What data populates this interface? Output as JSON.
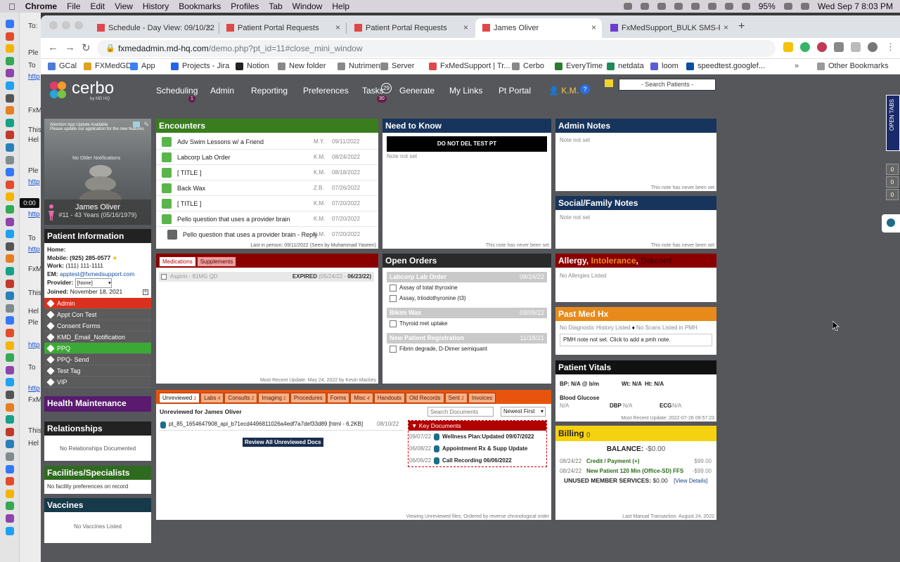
{
  "menubar": {
    "app": "Chrome",
    "items": [
      "File",
      "Edit",
      "View",
      "History",
      "Bookmarks",
      "Profiles",
      "Tab",
      "Window",
      "Help"
    ],
    "battery": "95%",
    "datetime": "Wed Sep 7  8:03 PM"
  },
  "behind": {
    "lines": [
      "To:",
      "Ple",
      "To",
      "http",
      "FxM",
      "This",
      "Hel",
      "Ple",
      "http",
      "Ple",
      "http",
      "To",
      "http",
      "FxM",
      "This",
      "Hel",
      "Ple",
      "http",
      "To",
      "http",
      "FxM",
      "This",
      "Hel"
    ],
    "timer": "0:00"
  },
  "tabs": [
    {
      "label": "Schedule - Day View: 09/10/22"
    },
    {
      "label": "Patient Portal Requests"
    },
    {
      "label": "Patient Portal Requests"
    },
    {
      "label": "James Oliver"
    },
    {
      "label": "FxMedSupport_BULK SMS-REP"
    }
  ],
  "address": {
    "host": "fxmedadmin.md-hq.com",
    "path": "/demo.php?pt_id=11#close_mini_window"
  },
  "bookmarks": [
    "GCal",
    "FXMedGD",
    "App",
    "Projects - Jira",
    "Notion",
    "New folder",
    "Nutrimentrx",
    "Server",
    "FxMedSupport | Tr...",
    "Cerbo",
    "EveryTime",
    "netdata",
    "loom",
    "speedtest.googlef..."
  ],
  "other_bookmarks": "Other Bookmarks",
  "nav": {
    "logo": "cerbo",
    "logo_sub": "by MD HQ",
    "items": [
      "Scheduling",
      "Admin",
      "Reporting",
      "Preferences",
      "Tasks",
      "Generate",
      "My Links",
      "Pt Portal"
    ],
    "scheduling_badge": "1",
    "tasks_count": "29",
    "tasks_badge": "30",
    "user": "K.M.",
    "help": "?",
    "search": "- Search Patients -"
  },
  "open_tabs": {
    "label": "OPEN TABS",
    "counts": [
      "0",
      "0",
      "0"
    ]
  },
  "patient": {
    "photo_header": "Attention App Update Available",
    "photo_sub": "Please update our application for the new features",
    "no_notifications": "No Older Notifications",
    "name": "James Oliver",
    "meta": "#11 - 43 Years (05/16/1979)"
  },
  "patient_info": {
    "title": "Patient Information",
    "home_label": "Home:",
    "mobile_label": "Mobile:",
    "mobile": "(925) 285-0577",
    "work_label": "Work:",
    "work": "(111) 111-1111",
    "em_label": "EM:",
    "email": "apptest@fxmedsupport.com",
    "provider_label": "Provider:",
    "provider": "[None]",
    "joined_label": "Joined:",
    "joined": "November 18, 2021"
  },
  "tags": [
    {
      "label": "Admin",
      "color": "#d9311e"
    },
    {
      "label": "Appt Con Test",
      "color": "#5b5b5b"
    },
    {
      "label": "Consent Forms",
      "color": "#5b5b5b"
    },
    {
      "label": "KMD_Email_Notification",
      "color": "#5b5b5b"
    },
    {
      "label": "PPQ",
      "color": "#3aaa35"
    },
    {
      "label": "PPQ- Send",
      "color": "#5b5b5b"
    },
    {
      "label": "Test Tag",
      "color": "#5b5b5b"
    },
    {
      "label": "VIP",
      "color": "#5b5b5b"
    }
  ],
  "health_maintenance": {
    "title": "Health Maintenance"
  },
  "relationships": {
    "title": "Relationships",
    "empty": "No Relationships Documented"
  },
  "facilities": {
    "title": "Facilities/Specialists",
    "empty": "No facility preferences on record"
  },
  "vaccines": {
    "title": "Vaccines",
    "empty": "No Vaccines Listed"
  },
  "encounters": {
    "title": "Encounters",
    "rows": [
      {
        "title": "Adv Swim Lessons w/ a Friend",
        "who": "M.Y.",
        "date": "09/11/2022"
      },
      {
        "title": "Labcorp Lab Order",
        "who": "K.M.",
        "date": "08/24/2022"
      },
      {
        "title": "[ TITLE ]",
        "who": "K.M.",
        "date": "08/18/2022"
      },
      {
        "title": "Back Wax",
        "who": "Z.B.",
        "date": "07/26/2022"
      },
      {
        "title": "[ TITLE ]",
        "who": "K.M.",
        "date": "07/20/2022"
      },
      {
        "title": "Pello question that uses a provider brain",
        "who": "K.M.",
        "date": "07/20/2022"
      },
      {
        "title": "Pello question that uses a provider brain - Reply",
        "who": "K.M.",
        "date": "07/20/2022"
      }
    ],
    "footer": "Last in person: 09/11/2022 (Seen by Muhammad Yaseen)"
  },
  "need_to_know": {
    "title": "Need to Know",
    "banner": "DO NOT DEL TEST PT",
    "note": "Note not set",
    "footer": "This note has never been set"
  },
  "admin_notes": {
    "title": "Admin Notes",
    "note": "Note not set",
    "footer": "This note has never been set"
  },
  "social": {
    "title": "Social/Family Notes",
    "note": "Note not set",
    "footer": "This note has never been set"
  },
  "medications": {
    "tabs": [
      "Medications",
      "Supplements"
    ],
    "item": "Aspirin - 81MG QD",
    "status": "EXPIRED",
    "range_start": "(05/24/22 - ",
    "range_end": "06/23/22)",
    "footer": "Most Recent Update: May 24, 2022 by Kevin Mackey"
  },
  "open_orders": {
    "title": "Open Orders",
    "groups": [
      {
        "name": "Labcorp Lab Order",
        "date": "08/24/22",
        "items": [
          "Assay of total thyroxine",
          "Assay, triiodothyronine (t3)"
        ]
      },
      {
        "name": "Bikini Wax",
        "date": "03/09/22",
        "items": [
          "Thyroid met uptake"
        ]
      },
      {
        "name": "New Patient Registration",
        "date": "11/18/21",
        "items": [
          "Fibrin degrade, D-Dimer semiquant"
        ]
      }
    ]
  },
  "allergy": {
    "t1": "Allergy, ",
    "t2": "Intolerance",
    "t3": ", ",
    "t4": "Discont",
    "empty": "No Allergies Listed"
  },
  "pmh": {
    "title": "Past Med Hx",
    "diag": "No Diagnostic History Listed",
    "scans": "No Scans Listed in PMH",
    "note": "PMH note not set. Click to add a pmh note."
  },
  "vitals": {
    "title": "Patient Vitals",
    "bp": "BP: N/A @ b/m",
    "wt": "Wt: N/A",
    "ht": "Ht: N/A",
    "bg_label": "Blood Glucose",
    "bg": "N/A",
    "dbp_label": "DBP",
    "dbp": "N/A",
    "ecg_label": "ECG",
    "ecg": "N/A",
    "footer": "Most Recent Update: 2022-07-26 09:57:23"
  },
  "billing": {
    "title": "Billing",
    "count": "()",
    "balance_label": "BALANCE:",
    "balance": "-$0.00",
    "rows": [
      {
        "date": "08/24/22",
        "desc": "Credit / Payment (+)",
        "amt": "$99.00"
      },
      {
        "date": "08/24/22",
        "desc": "New Patient 120 Min (Office-SD) FFS",
        "amt": "-$99.00"
      }
    ],
    "unused_label": "UNUSED MEMBER SERVICES:",
    "unused": "$0.00",
    "view": "[View Details]",
    "footer": "Last Manual Transaction: August 24, 2022"
  },
  "documents": {
    "tabs": [
      {
        "label": "Unreviewed",
        "n": "1"
      },
      {
        "label": "Labs",
        "n": "4"
      },
      {
        "label": "Consults",
        "n": "2"
      },
      {
        "label": "Imaging",
        "n": "1"
      },
      {
        "label": "Procedures",
        "n": ""
      },
      {
        "label": "Forms",
        "n": ""
      },
      {
        "label": "Misc",
        "n": "4"
      },
      {
        "label": "Handouts",
        "n": ""
      },
      {
        "label": "Old Records",
        "n": ""
      },
      {
        "label": "Sent",
        "n": "1"
      },
      {
        "label": "Invoices",
        "n": ""
      }
    ],
    "heading": "Unreviewed for James Oliver",
    "search_placeholder": "Search Documents",
    "sort": "Newest First",
    "file": "pt_85_1654647908_api_b71ecd4496811026a4edf7a7def33d89 [html - 6.2KB]",
    "file_date": "08/10/22",
    "review_btn": "Review All Unreviewed Docs",
    "key_title": "Key Documents",
    "key_docs": [
      {
        "date": "09/07/22",
        "title": "Wellness Plan:Updated 09/07/2022"
      },
      {
        "date": "06/08/22",
        "title": "Appointment Rx & Supp Update"
      },
      {
        "date": "06/06/22",
        "title": "Call Recording 06/06/2022"
      }
    ],
    "footer": "Viewing Unreviewed files; Ordered by reverse chronological order"
  }
}
